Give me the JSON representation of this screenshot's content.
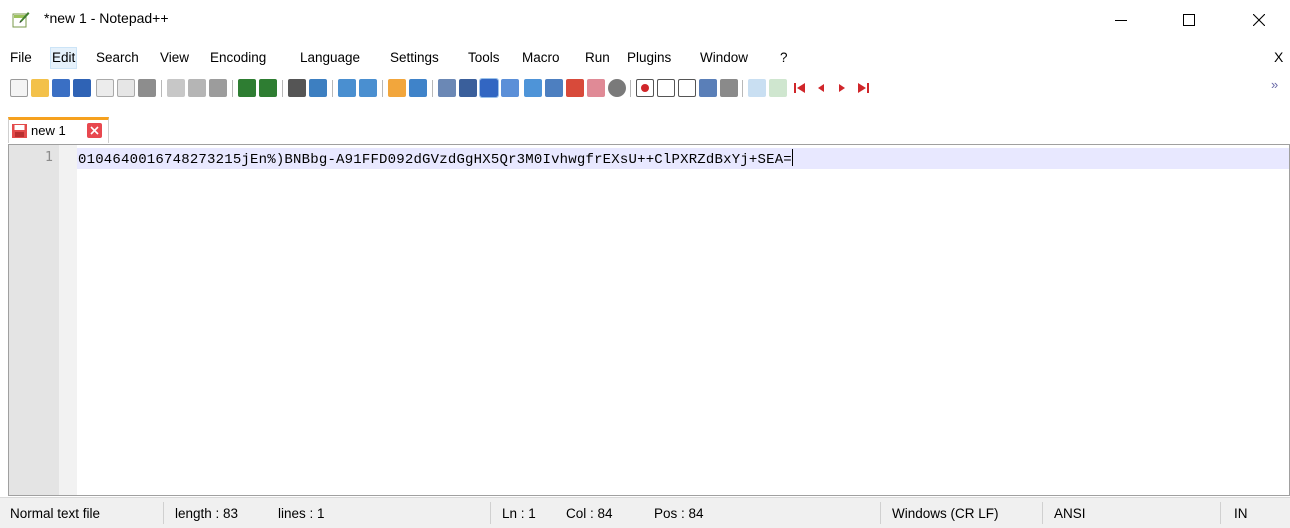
{
  "window": {
    "title": "*new 1 - Notepad++",
    "app_icon": "notepad-plus-plus-icon",
    "controls": [
      "minimize-icon",
      "maximize-icon",
      "close-icon"
    ]
  },
  "menu": {
    "items": [
      "File",
      "Edit",
      "Search",
      "View",
      "Encoding",
      "Language",
      "Settings",
      "Tools",
      "Macro",
      "Run",
      "Plugins",
      "Window",
      "?"
    ],
    "active": "Edit",
    "close_label": "X"
  },
  "toolbar": {
    "icons": [
      "new-file-icon",
      "open-file-icon",
      "save-icon",
      "save-all-icon",
      "close-icon",
      "close-all-icon",
      "print-icon",
      "cut-icon",
      "copy-icon",
      "paste-icon",
      "undo-icon",
      "redo-icon",
      "find-icon",
      "replace-icon",
      "zoom-in-icon",
      "zoom-out-icon",
      "sync-vertical-icon",
      "sync-horizontal-icon",
      "word-wrap-icon",
      "show-all-characters-icon",
      "indent-guide-icon",
      "user-defined-language-icon",
      "document-map-icon",
      "function-list-icon",
      "folder-as-workspace-icon",
      "monitoring-icon",
      "record-macro-icon",
      "stop-recording-icon",
      "playback-macro-icon",
      "run-macro-multiple-icon",
      "save-macro-icon",
      "plugin-icon-1",
      "plugin-icon-2",
      "first-bookmark-icon",
      "prev-bookmark-icon",
      "next-bookmark-icon",
      "last-bookmark-icon"
    ],
    "more_label": "»"
  },
  "tabs": [
    {
      "label": "new 1",
      "icon": "unsaved-file-icon",
      "close_icon": "tab-close-icon"
    }
  ],
  "editor": {
    "lines": [
      {
        "number": "1",
        "text": "0104640016748273215jEn%)BNBbg-A91FFD092dGVzdGgHX5Qr3M0IvhwgfrEXsU++ClPXRZdBxYj+SEA="
      }
    ]
  },
  "status": {
    "file_type": "Normal text file",
    "length": "length : 83",
    "lines": "lines : 1",
    "ln": "Ln : 1",
    "col": "Col : 84",
    "pos": "Pos : 84",
    "eol": "Windows (CR LF)",
    "encoding": "ANSI",
    "mode": "IN"
  },
  "colors": {
    "tab_accent": "#f6a11e",
    "current_line": "#e8e8ff",
    "gutter": "#e4e4e4",
    "status_bg": "#f0f0f0",
    "tab_close": "#e8484f"
  }
}
